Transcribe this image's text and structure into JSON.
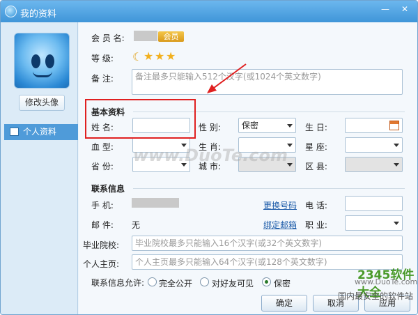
{
  "window": {
    "title": "我的资料",
    "minimize_glyph": "—",
    "close_glyph": "✕"
  },
  "sidebar": {
    "change_avatar": "修改头像",
    "nav_item": "个人资料"
  },
  "profile": {
    "member_label": "会 员 名:",
    "vip_badge": "会员",
    "level_label": "等    级:",
    "level_moon": "☾",
    "level_stars": [
      "★",
      "★",
      "★"
    ],
    "note_label": "备    注:",
    "note_placeholder": "备注最多只能输入512个汉字(或1024个英文数字)"
  },
  "basic": {
    "title": "基本资料",
    "name_label": "姓    名:",
    "gender_label": "性    别:",
    "gender_value": "保密",
    "birthday_label": "生    日:",
    "blood_label": "血    型:",
    "zodiac_label": "生    肖:",
    "constellation_label": "星    座:",
    "province_label": "省    份:",
    "city_label": "城    市:",
    "district_label": "区    县:"
  },
  "contact": {
    "title": "联系信息",
    "mobile_label": "手    机:",
    "change_number": "更换号码",
    "phone_label": "电    话:",
    "email_label": "邮    件:",
    "email_value": "无",
    "bind_email": "绑定邮箱",
    "job_label": "职    业:",
    "school_label": "毕业院校:",
    "school_placeholder": "毕业院校最多只能输入16个汉字(或32个英文数字)",
    "homepage_label": "个人主页:",
    "homepage_placeholder": "个人主页最多只能输入64个汉字(或128个英文数字)",
    "visibility_label": "联系信息允许:",
    "visibility_options": [
      "完全公开",
      "对好友可见",
      "保密"
    ],
    "visibility_selected": "保密"
  },
  "buttons": {
    "ok": "确定",
    "cancel": "取消",
    "apply": "应用"
  },
  "watermarks": {
    "center": "www.DuoTe.com",
    "logo": "2345软件大全",
    "logo_url": "www.DuoTe.com",
    "tagline": "国内最安全的软件站"
  },
  "colors": {
    "titlebar": "#3f95d8",
    "annotation": "#e02020",
    "nav_selected": "#4f9bd9"
  }
}
